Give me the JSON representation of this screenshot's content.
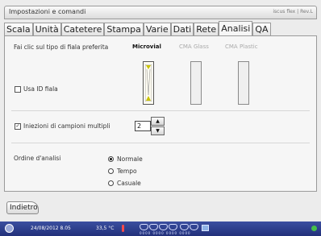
{
  "window": {
    "title": "Impostazioni e comandi",
    "brand": "iscus flex | Rev.L"
  },
  "tabs": [
    {
      "label": "Scala",
      "active": false
    },
    {
      "label": "Unità",
      "active": false
    },
    {
      "label": "Catetere",
      "active": false
    },
    {
      "label": "Stampa",
      "active": false
    },
    {
      "label": "Varie",
      "active": false
    },
    {
      "label": "Dati",
      "active": false
    },
    {
      "label": "Rete",
      "active": false
    },
    {
      "label": "Analisi",
      "active": true
    },
    {
      "label": "QA",
      "active": false
    }
  ],
  "vial": {
    "prompt": "Fai clic sul tipo di fiala preferita",
    "options": [
      {
        "label": "Microvial",
        "selected": true
      },
      {
        "label": "CMA Glass",
        "selected": false
      },
      {
        "label": "CMA Plastic",
        "selected": false
      }
    ]
  },
  "use_vial_id": {
    "label": "Usa ID fiala",
    "checked": false
  },
  "multiple_injections": {
    "label": "Iniezioni di campioni multipli",
    "checked": true,
    "value": "2"
  },
  "analysis_order": {
    "label": "Ordine d'analisi",
    "options": [
      {
        "label": "Normale",
        "selected": true
      },
      {
        "label": "Tempo",
        "selected": false
      },
      {
        "label": "Casuale",
        "selected": false
      }
    ]
  },
  "back_button": {
    "label": "Indietro"
  },
  "status": {
    "date_time": "24/08/2012 8.05",
    "temperature": "33,5 °C",
    "tray_numbers": "0000 0000 0000 0000"
  },
  "colors": {
    "accent_yellow": "#c9c200",
    "status_bar": "#2e3d8c",
    "online_dot": "#45c04a",
    "thermo_red": "#ff4a4a"
  }
}
